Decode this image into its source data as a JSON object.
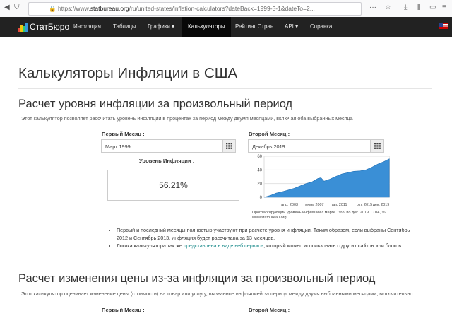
{
  "browser": {
    "url_prefix": "https://www.",
    "url_domain": "statbureau.org",
    "url_rest": "/ru/united-states/inflation-calculators?dateBack=1999-3-1&dateTo=2..."
  },
  "nav": {
    "brand": "СтатБюро",
    "items": [
      {
        "label": "Инфляция"
      },
      {
        "label": "Таблицы"
      },
      {
        "label": "Графики ▾"
      },
      {
        "label": "Калькуляторы"
      },
      {
        "label": "Рейтинг Стран"
      },
      {
        "label": "API ▾"
      },
      {
        "label": "Справка"
      }
    ],
    "logo_colors": [
      "#e64b3c",
      "#f1c40f",
      "#2ecc71",
      "#3498db"
    ]
  },
  "page": {
    "title": "Калькуляторы Инфляции в США",
    "section1": {
      "heading": "Расчет уровня инфляции за произвольный период",
      "description": "Этот калькулятор позволяет рассчитать уровень инфляции в процентах за период между двумя месяцами, включая оба выбранных месяца",
      "first_month_label": "Первый Месяц :",
      "first_month_value": "Март 1999",
      "second_month_label": "Второй Месяц :",
      "second_month_value": "Декабрь 2019",
      "result_label": "Уровень Инфляции :",
      "result_value": "56.21%",
      "notes": [
        "Первый и последний месяцы полностью участвуют при расчете уровня инфляции. Таким образом, если выбраны Сентябрь 2012 и Сентябрь 2013, инфляция будет рассчитана за 13 месяцев."
      ],
      "note2_before": "Логика калькулятора так же ",
      "note2_link": "представлена в виде веб сервиса",
      "note2_after": ", который можно использовать с других сайтов или блогов."
    },
    "section2": {
      "heading": "Расчет изменения цены из-за инфляции за произвольный период",
      "description": "Этот калькулятор оценивает изменение цены (стоимости) на товар или услугу, вызванное инфляцией за период между двумя выбранными месяцами, включительно.",
      "first_month_label": "Первый Месяц :",
      "second_month_label": "Второй Месяц :"
    }
  },
  "chart_data": {
    "type": "area",
    "x_tick_labels": [
      "апр. 2003",
      "июнь 2007",
      "авг. 2011",
      "окт. 2015",
      "дек. 2019"
    ],
    "y_ticks": [
      0,
      20,
      40,
      60
    ],
    "ylim": [
      0,
      60
    ],
    "color": "#3a8fd6",
    "x": [
      1999,
      2000,
      2001,
      2002,
      2003,
      2004,
      2005,
      2006,
      2007,
      2008,
      2008.5,
      2009,
      2010,
      2011,
      2012,
      2013,
      2014,
      2015,
      2016,
      2017,
      2018,
      2019,
      2019.9
    ],
    "values": [
      0,
      2.5,
      6,
      8,
      10.5,
      13,
      16.5,
      20,
      22.5,
      27.5,
      28.5,
      23.5,
      26.5,
      30.5,
      34,
      36,
      38,
      38.5,
      40,
      44,
      48.5,
      52,
      56.2
    ],
    "caption": "Прогрессирующий уровень инфляции с марте 1999 по дек. 2019, США, % www.statbureau.org"
  }
}
